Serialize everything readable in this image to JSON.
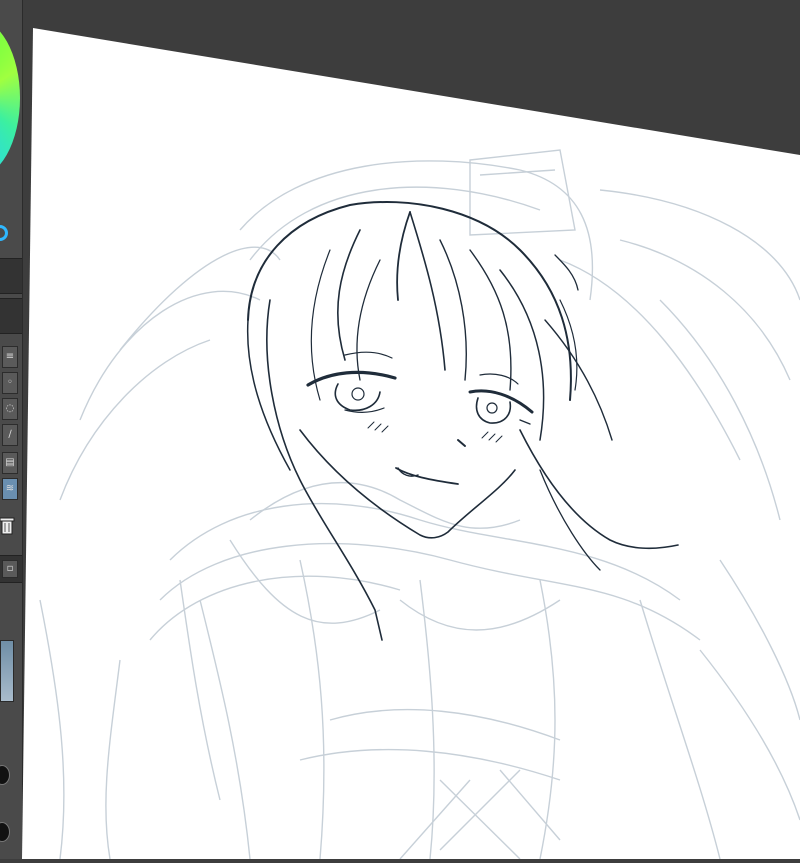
{
  "app": {
    "icons": {
      "color_wheel": "color-wheel-icon",
      "swatch": "color-swatch-icon",
      "trash": "trash-icon",
      "layer_thumbnail": "layer-thumbnail"
    },
    "colors": {
      "workspace": "#3d3d3d",
      "canvas": "#ffffff",
      "line_art": "#1f2c3a",
      "sketch": "#c7d0d8",
      "accent": "#2fb8ff"
    }
  }
}
